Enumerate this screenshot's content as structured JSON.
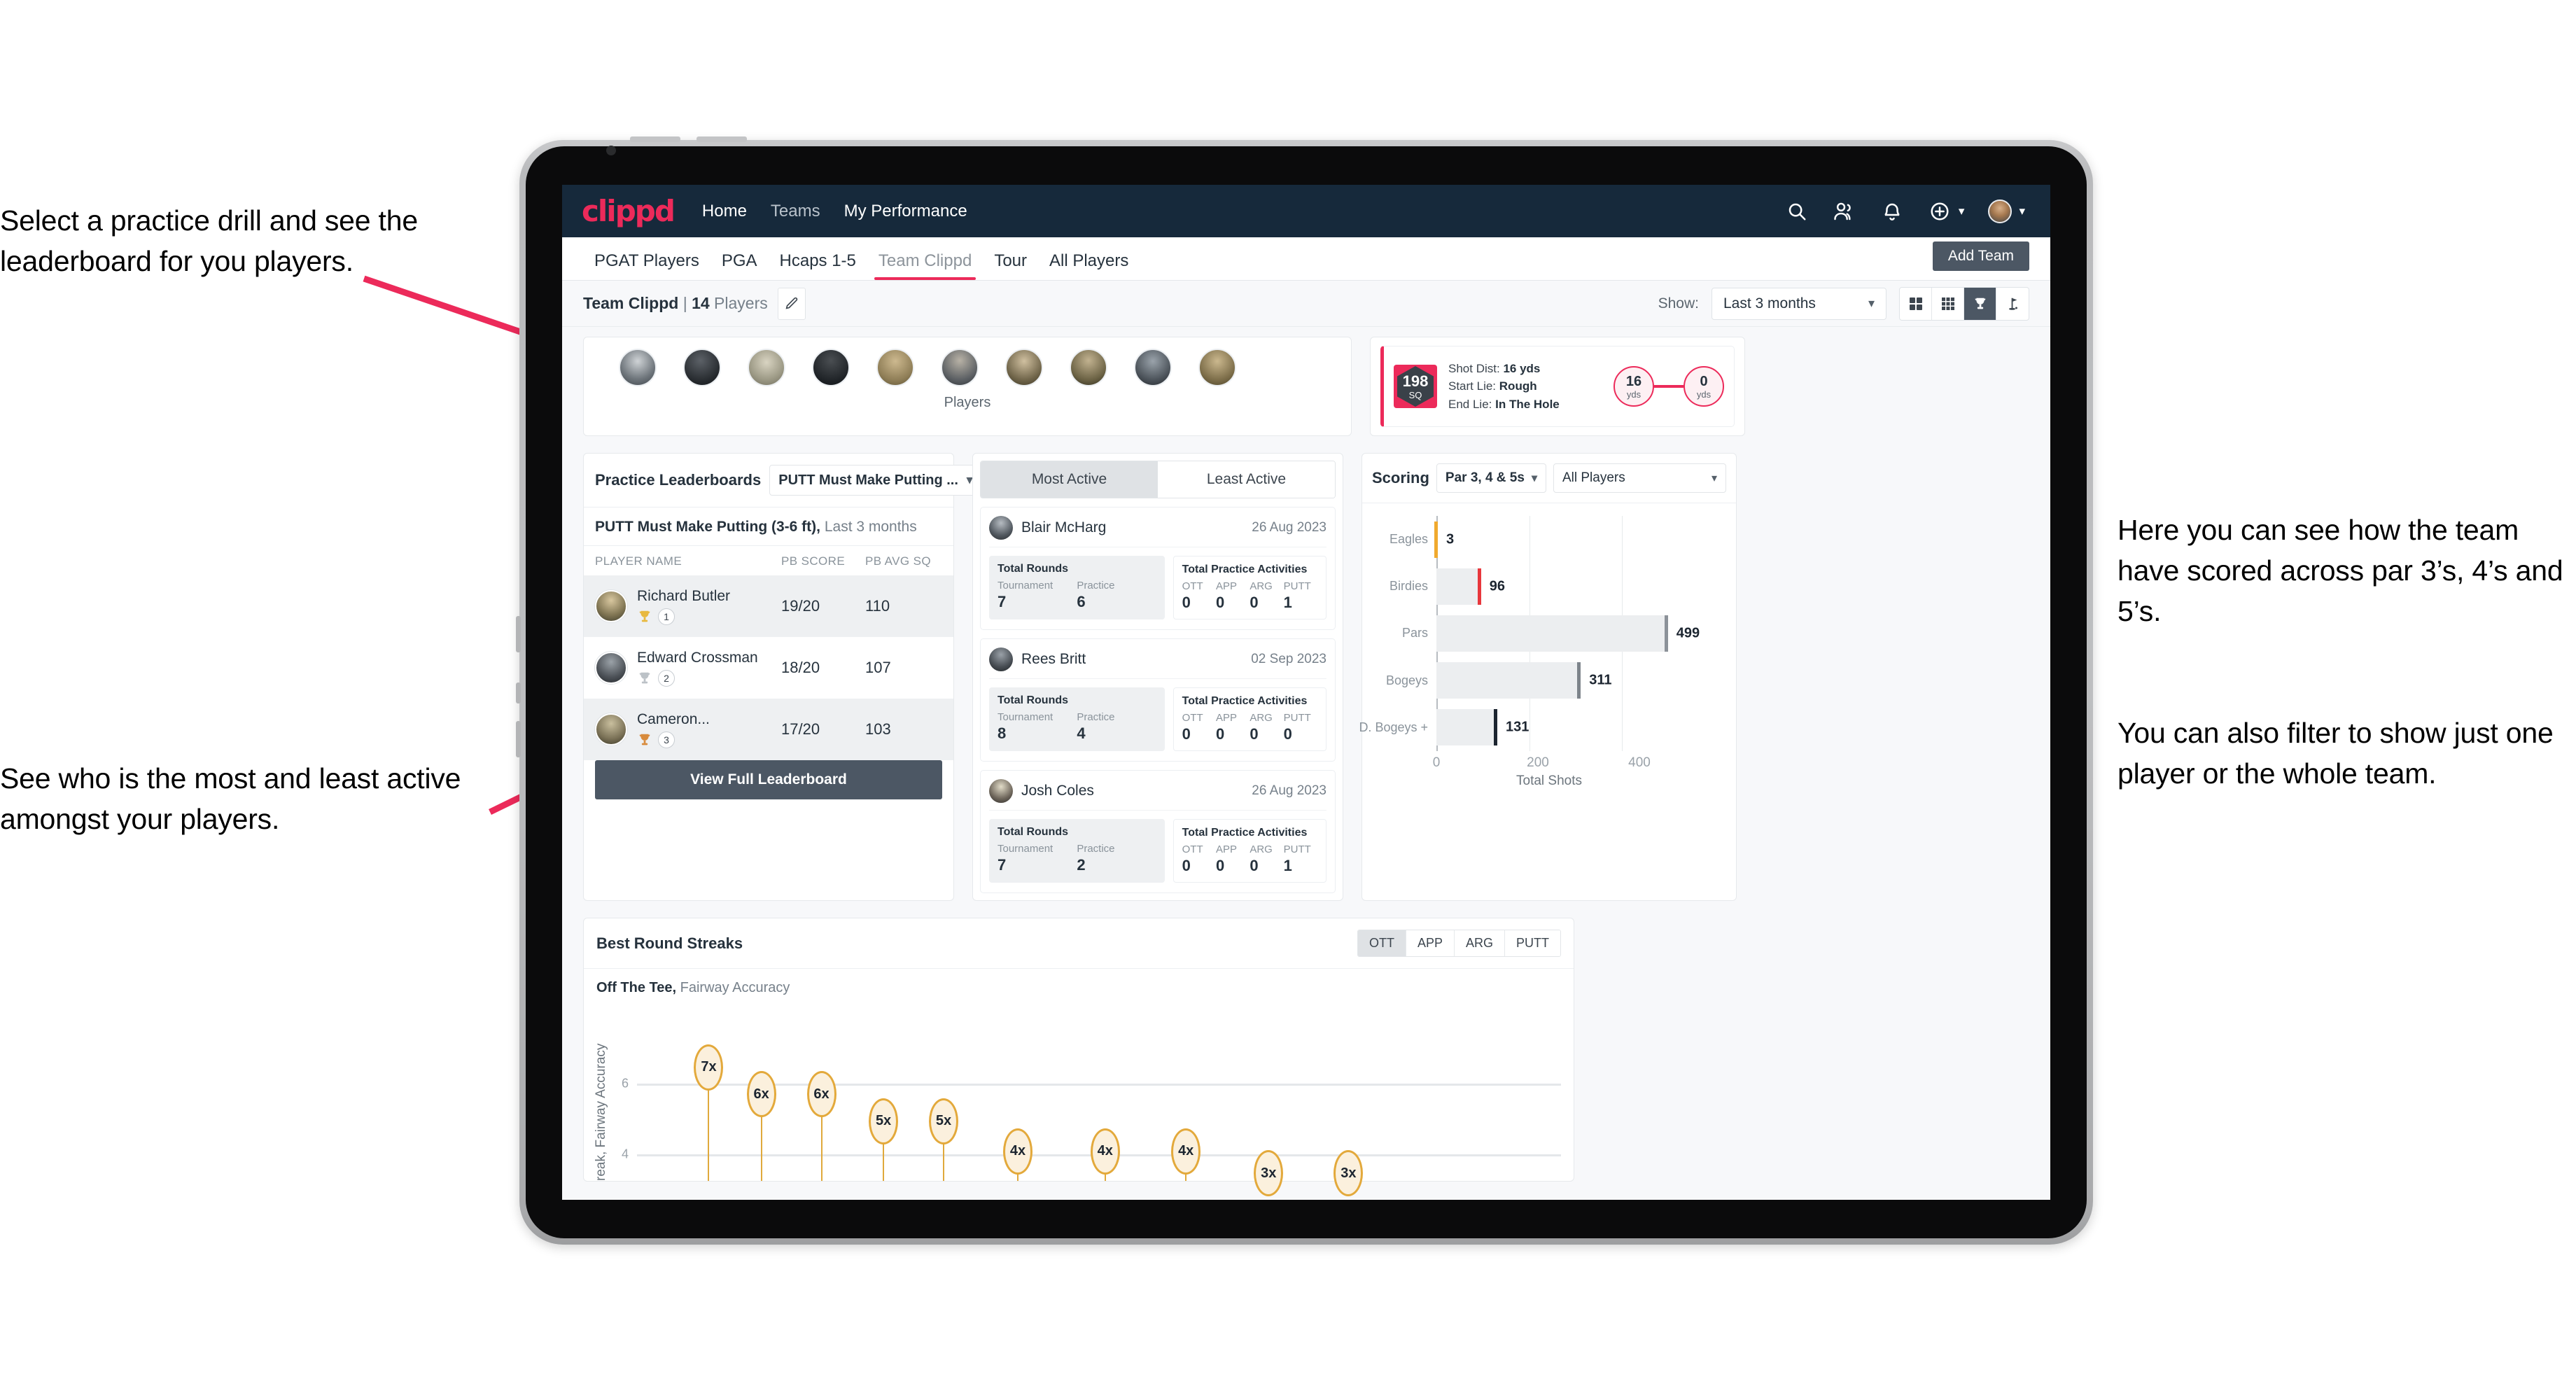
{
  "annotations": [
    {
      "id": "a1",
      "text": "Select a practice drill and see the leaderboard for you players."
    },
    {
      "id": "a2",
      "text": "See who is the most and least active amongst your players."
    },
    {
      "id": "a3",
      "text": "Here you can see how the team have scored across par 3’s, 4’s and 5’s."
    },
    {
      "id": "a4",
      "text": "You can also filter to show just one player or the whole team."
    }
  ],
  "colors": {
    "brand_pink": "#ec2a5a",
    "navbar": "#16293b",
    "slate": "#4c5764",
    "gold": "#e3a93b"
  },
  "appbar": {
    "logo": "clippd",
    "links": [
      {
        "label": "Home",
        "active": true
      },
      {
        "label": "Teams",
        "active": false
      },
      {
        "label": "My Performance",
        "active": true
      }
    ],
    "icons": [
      "search-icon",
      "people-icon",
      "bell-icon",
      "plus-circle-icon",
      "avatar"
    ]
  },
  "tabs": {
    "items": [
      {
        "label": "PGAT Players",
        "active": false
      },
      {
        "label": "PGA",
        "active": false
      },
      {
        "label": "Hcaps 1-5",
        "active": false
      },
      {
        "label": "Team Clippd",
        "active": true
      },
      {
        "label": "Tour",
        "active": false
      },
      {
        "label": "All Players",
        "active": false
      }
    ],
    "add_team_label": "Add Team"
  },
  "subheader": {
    "team_name": "Team Clippd",
    "separator": " | ",
    "player_count": "14",
    "players_word": " Players",
    "show_label": "Show:",
    "period_value": "Last 3 months",
    "view_modes": [
      "grid-large-icon",
      "grid-small-icon",
      "trophy-icon",
      "flag-icon"
    ],
    "active_view_mode": "trophy-icon"
  },
  "players_strip": {
    "caption": "Players",
    "count": 10
  },
  "shot_card": {
    "sq_value": "198",
    "sq_label": "SQ",
    "shot_dist_label": "Shot Dist:",
    "shot_dist_value": "16 yds",
    "start_lie_label": "Start Lie:",
    "start_lie_value": "Rough",
    "end_lie_label": "End Lie:",
    "end_lie_value": "In The Hole",
    "from_value": "16",
    "from_unit": "yds",
    "to_value": "0",
    "to_unit": "yds"
  },
  "practice_leaderboard": {
    "title": "Practice Leaderboards",
    "drill_select": "PUTT Must Make Putting ...",
    "subtitle_bold": "PUTT Must Make Putting (3-6 ft),",
    "subtitle_muted": " Last 3 months",
    "columns": [
      "PLAYER NAME",
      "PB SCORE",
      "PB AVG SQ"
    ],
    "rows": [
      {
        "name": "Richard Butler",
        "rank": "1",
        "trophy": "gold",
        "pb_score": "19/20",
        "pb_avg_sq": "110"
      },
      {
        "name": "Edward Crossman",
        "rank": "2",
        "trophy": "silver",
        "pb_score": "18/20",
        "pb_avg_sq": "107"
      },
      {
        "name": "Cameron...",
        "rank": "3",
        "trophy": "bronze",
        "pb_score": "17/20",
        "pb_avg_sq": "103"
      }
    ],
    "button_label": "View Full Leaderboard"
  },
  "activity": {
    "tabs": [
      {
        "label": "Most Active",
        "active": true
      },
      {
        "label": "Least Active",
        "active": false
      }
    ],
    "rounds_label": "Total Rounds",
    "rounds_keys": [
      "Tournament",
      "Practice"
    ],
    "acts_label": "Total Practice Activities",
    "acts_keys": [
      "OTT",
      "APP",
      "ARG",
      "PUTT"
    ],
    "items": [
      {
        "name": "Blair McHarg",
        "date": "26 Aug 2023",
        "tournament": "7",
        "practice": "6",
        "ott": "0",
        "app": "0",
        "arg": "0",
        "putt": "1"
      },
      {
        "name": "Rees Britt",
        "date": "02 Sep 2023",
        "tournament": "8",
        "practice": "4",
        "ott": "0",
        "app": "0",
        "arg": "0",
        "putt": "0"
      },
      {
        "name": "Josh Coles",
        "date": "26 Aug 2023",
        "tournament": "7",
        "practice": "2",
        "ott": "0",
        "app": "0",
        "arg": "0",
        "putt": "1"
      }
    ]
  },
  "scoring": {
    "title": "Scoring",
    "par_select": "Par 3, 4 & 5s",
    "player_select": "All Players"
  },
  "streaks": {
    "title": "Best Round Streaks",
    "segments": [
      {
        "label": "OTT",
        "active": true
      },
      {
        "label": "APP",
        "active": false
      },
      {
        "label": "ARG",
        "active": false
      },
      {
        "label": "PUTT",
        "active": false
      }
    ],
    "sub_bold": "Off The Tee,",
    "sub_muted": " Fairway Accuracy",
    "ylabel": "reak, Fairway Accuracy"
  },
  "chart_data": [
    {
      "type": "bar",
      "orientation": "horizontal",
      "title": "Scoring",
      "categories": [
        "Eagles",
        "Birdies",
        "Pars",
        "Bogeys",
        "D. Bogeys +"
      ],
      "values": [
        3,
        96,
        499,
        311,
        131
      ],
      "cap_colors": [
        "#f0a92e",
        "#e8373c",
        "#8c9299",
        "#7d848b",
        "#1c2530"
      ],
      "xlabel": "Total Shots",
      "ylabel": "",
      "xticks": [
        0,
        200,
        400
      ],
      "xlim": [
        0,
        540
      ],
      "grid": true,
      "legend": "none"
    },
    {
      "type": "scatter",
      "title": "Best Round Streaks",
      "subtitle": "Off The Tee, Fairway Accuracy",
      "ylabel": "reak, Fairway Accuracy",
      "xlabel": "",
      "labels": [
        "7x",
        "6x",
        "6x",
        "5x",
        "5x",
        "4x",
        "4x",
        "4x",
        "3x",
        "3x"
      ],
      "values": [
        7,
        6,
        6,
        5,
        5,
        4,
        4,
        4,
        3,
        3
      ],
      "yticks": [
        4,
        6
      ],
      "ylim": [
        0,
        8
      ],
      "grid": true,
      "legend": "none"
    }
  ]
}
